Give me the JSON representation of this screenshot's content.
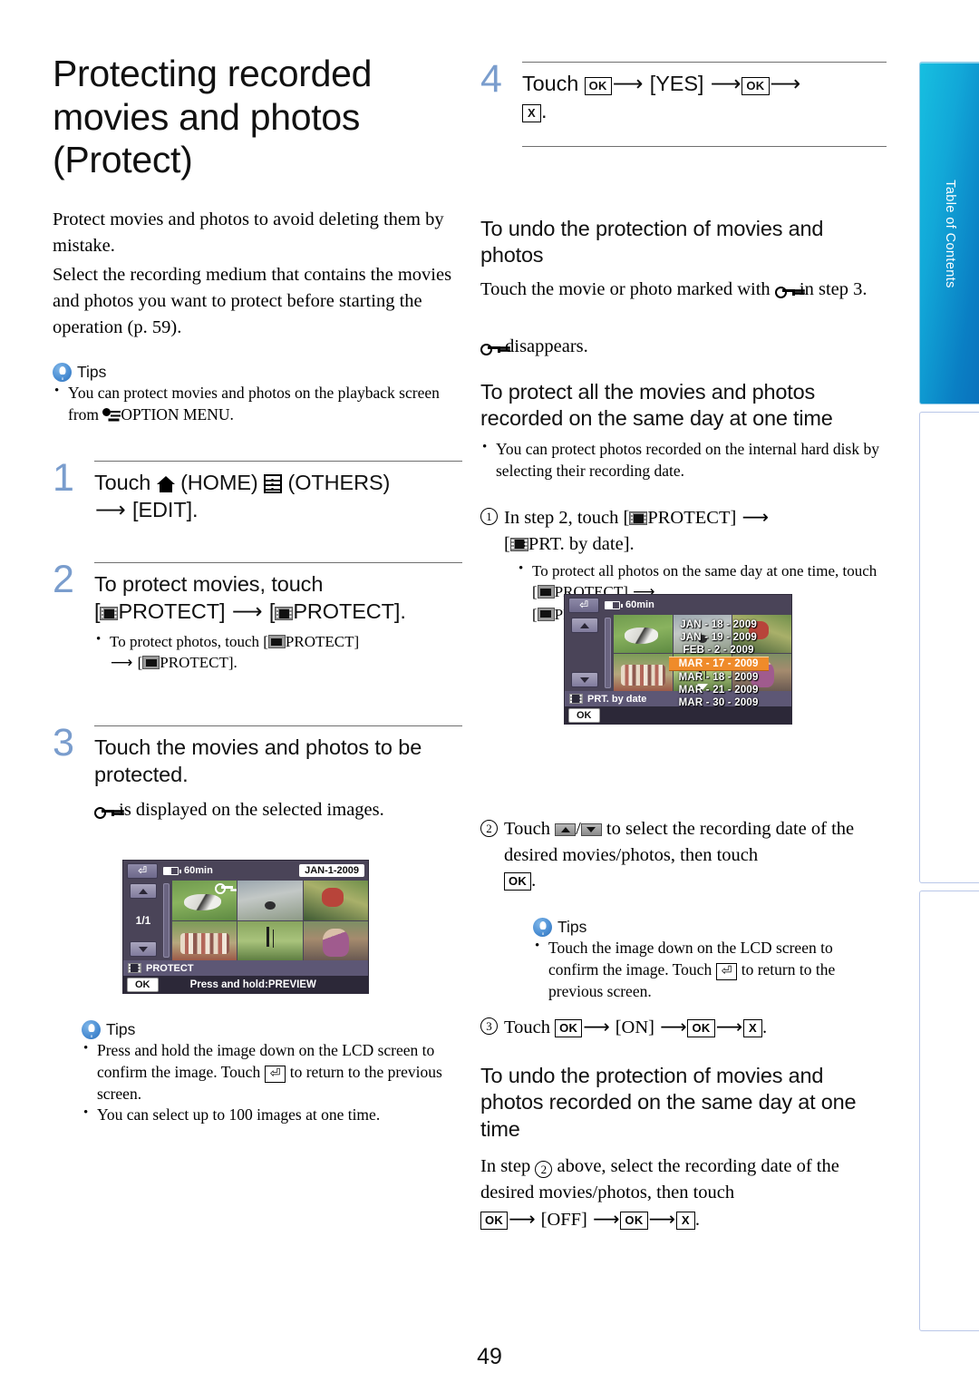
{
  "sidebar": {
    "tab_label": "Table of Contents"
  },
  "page_number": "49",
  "left": {
    "title": "Protecting recorded movies and photos (Protect)",
    "intro_p1": "Protect movies and photos to avoid deleting them by mistake.",
    "intro_p2": "Select the recording medium that contains the movies and photos you want to protect before starting the operation (p. 59).",
    "tips1": {
      "label": "Tips",
      "item1_a": "You can protect movies and photos on the playback screen from ",
      "item1_b": "OPTION MENU."
    },
    "step1": {
      "num": "1",
      "t1": "Touch ",
      "t2": " (HOME) ",
      "t3": " (OTHERS) ",
      "t4": " [EDIT]."
    },
    "step2": {
      "num": "2",
      "t1": "To protect movies, touch",
      "t2": "[",
      "t3": "PROTECT] ",
      "t4": " [",
      "t5": "PROTECT].",
      "note_a": "To protect photos, touch [",
      "note_b": "PROTECT]",
      "note_c": " [",
      "note_d": "PROTECT]."
    },
    "step3": {
      "num": "3",
      "t1": "Touch the movies and photos to be protected.",
      "note": " is displayed on the selected images."
    },
    "tips2": {
      "label": "Tips",
      "item1_a": "Press and hold the image down on the LCD screen to confirm the image. Touch ",
      "item1_b": " to return to the previous screen.",
      "item2": "You can select up to 100 images at one time."
    },
    "lcd1": {
      "battery": "60min",
      "date_badge": "JAN-1-2009",
      "page_indicator": "1/1",
      "mode_label": "PROTECT",
      "ok_label": "OK",
      "hint": "Press and hold:PREVIEW"
    }
  },
  "right": {
    "step4": {
      "num": "4",
      "t1": "Touch ",
      "ok1": "OK",
      "t2": " [YES] ",
      "ok2": "OK",
      "t3": " ",
      "x": "X",
      "t4": "."
    },
    "h_undo": "To undo the protection of movies and photos",
    "undo_p1_a": "Touch the movie or photo marked with ",
    "undo_p1_b": " in step 3.",
    "undo_p2": " disappears.",
    "h_allday": "To protect all the movies and photos recorded on the same day at one time",
    "allday_tip": "You can protect photos recorded on the internal hard disk by selecting their recording date.",
    "item1": {
      "marker": "1",
      "a": "In step 2, touch [",
      "b": "PROTECT] ",
      "c": " [",
      "d": "PRT. by date].",
      "sub_a": "To protect all photos on the same day at one time, touch [",
      "sub_b": "PROTECT] ",
      "sub_c": " [",
      "sub_d": "PRT. by date]."
    },
    "item2": {
      "marker": "2",
      "a": "Touch ",
      "b": "/",
      "c": " to select the recording date of the desired movies/photos, then touch ",
      "ok": "OK",
      "d": "."
    },
    "tips3": {
      "label": "Tips",
      "item1_a": "Touch the image down on the LCD screen to confirm the image. Touch ",
      "item1_b": " to return to the previous screen."
    },
    "item3": {
      "marker": "3",
      "a": "Touch ",
      "ok1": "OK",
      "b": " [ON] ",
      "ok2": "OK",
      "c": " ",
      "x": "X",
      "d": "."
    },
    "h_undo_day": "To undo the protection of movies and photos recorded on the same day at one time",
    "undo_day_a": "In step ",
    "undo_day_marker": "2",
    "undo_day_b": " above, select the recording date of the desired movies/photos, then touch ",
    "undo_day_ok1": "OK",
    "undo_day_c": " [OFF] ",
    "undo_day_ok2": "OK",
    "undo_day_d": " ",
    "undo_day_x": "X",
    "undo_day_e": ".",
    "lcd2": {
      "battery": "60min",
      "mode_label": "PRT. by date",
      "ok_label": "OK",
      "dates": [
        "JAN - 18 - 2009",
        "JAN - 19 - 2009",
        "FEB -  2 - 2009",
        "MAR - 17 - 2009",
        "MAR - 18 - 2009",
        "MAR - 21 - 2009",
        "MAR - 30 - 2009"
      ],
      "selected_index": 3
    }
  }
}
